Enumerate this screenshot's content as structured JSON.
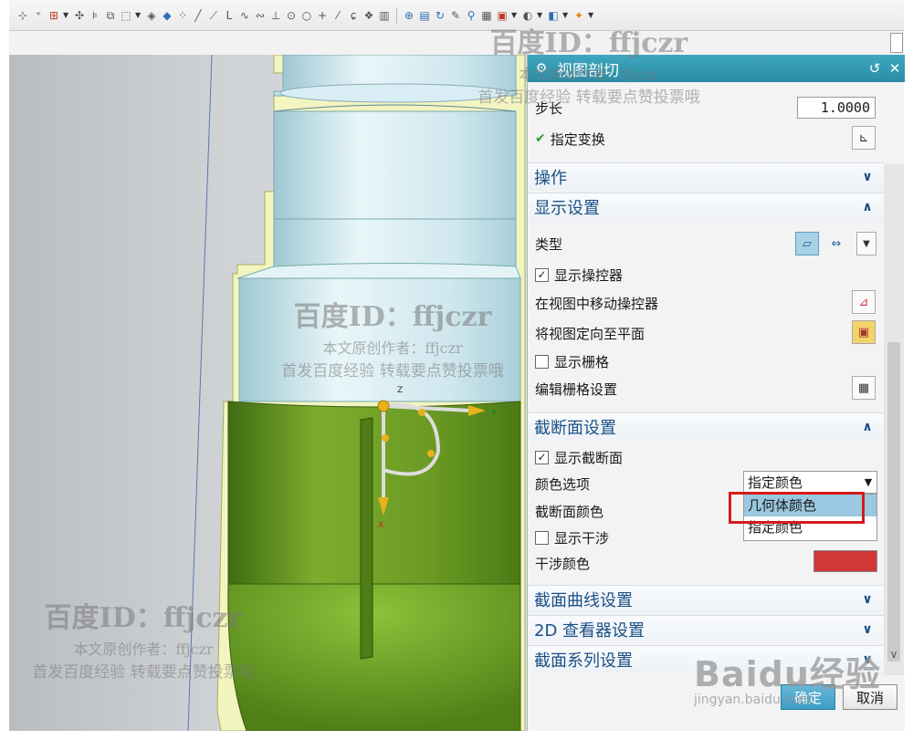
{
  "dialog": {
    "title": "视图剖切",
    "step_label": "步长",
    "step_value": "1.0000",
    "specify_transform": "指定变换",
    "operations": "操作",
    "display_settings": "显示设置",
    "type_label": "类型",
    "show_manipulator": "显示操控器",
    "move_manipulator_in_view": "在视图中移动操控器",
    "orient_view_to_plane": "将视图定向至平面",
    "show_grid": "显示栅格",
    "edit_grid_settings": "编辑栅格设置",
    "section_settings": "截断面设置",
    "show_section": "显示截断面",
    "color_option_label": "颜色选项",
    "color_option_value": "指定颜色",
    "color_options": [
      "几何体颜色",
      "指定颜色"
    ],
    "section_color_label": "截断面颜色",
    "show_interference": "显示干涉",
    "interference_color_label": "干涉颜色",
    "interference_color": "#d03737",
    "section_curve_settings": "截面曲线设置",
    "viewer_2d_settings": "2D 查看器设置",
    "section_series_settings": "截面系列设置",
    "ok": "确定",
    "cancel": "取消"
  },
  "watermark": {
    "id_line": "百度ID：ffjczr",
    "author_line": "本文原创作者：ffjczr",
    "promo_line": "首发百度经验 转载要点赞投票哦",
    "baidu": "Baidu经验",
    "baidu_url": "jingyan.baidu.com"
  },
  "colors": {
    "accent": "#2a8da6",
    "section_text": "#1a4f86",
    "part_green": "#6a9a23",
    "part_cyan": "#cfeaf1",
    "highlight_red": "#d61a1a"
  }
}
